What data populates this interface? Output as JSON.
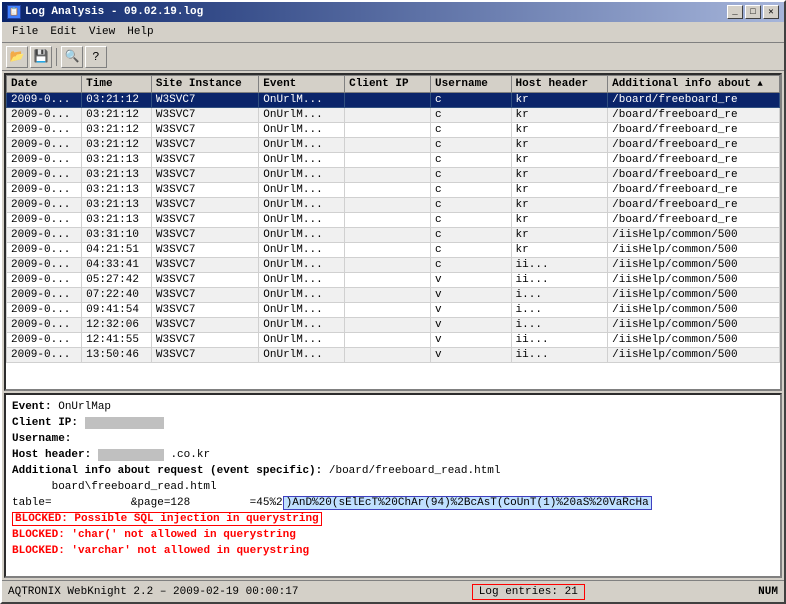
{
  "window": {
    "title": "Log Analysis - 09.02.19.log",
    "icon": "📋"
  },
  "menu": {
    "items": [
      "File",
      "Edit",
      "View",
      "Help"
    ]
  },
  "toolbar": {
    "buttons": [
      "open",
      "save",
      "separator",
      "find",
      "help"
    ]
  },
  "table": {
    "columns": [
      {
        "label": "Date",
        "width": 70
      },
      {
        "label": "Time",
        "width": 65
      },
      {
        "label": "Site Instance",
        "width": 100
      },
      {
        "label": "Event",
        "width": 80
      },
      {
        "label": "Client IP",
        "width": 80
      },
      {
        "label": "Username",
        "width": 75
      },
      {
        "label": "Host header",
        "width": 90
      },
      {
        "label": "Additional info about ^",
        "width": 160
      }
    ],
    "rows": [
      [
        "2009-0...",
        "03:21:12",
        "W3SVC7",
        "OnUrlM...",
        "",
        "c",
        "kr",
        "/board/freeboard_re"
      ],
      [
        "2009-0...",
        "03:21:12",
        "W3SVC7",
        "OnUrlM...",
        "",
        "c",
        "kr",
        "/board/freeboard_re"
      ],
      [
        "2009-0...",
        "03:21:12",
        "W3SVC7",
        "OnUrlM...",
        "",
        "c",
        "kr",
        "/board/freeboard_re"
      ],
      [
        "2009-0...",
        "03:21:12",
        "W3SVC7",
        "OnUrlM...",
        "",
        "c",
        "kr",
        "/board/freeboard_re"
      ],
      [
        "2009-0...",
        "03:21:13",
        "W3SVC7",
        "OnUrlM...",
        "",
        "c",
        "kr",
        "/board/freeboard_re"
      ],
      [
        "2009-0...",
        "03:21:13",
        "W3SVC7",
        "OnUrlM...",
        "",
        "c",
        "kr",
        "/board/freeboard_re"
      ],
      [
        "2009-0...",
        "03:21:13",
        "W3SVC7",
        "OnUrlM...",
        "",
        "c",
        "kr",
        "/board/freeboard_re"
      ],
      [
        "2009-0...",
        "03:21:13",
        "W3SVC7",
        "OnUrlM...",
        "",
        "c",
        "kr",
        "/board/freeboard_re"
      ],
      [
        "2009-0...",
        "03:21:13",
        "W3SVC7",
        "OnUrlM...",
        "",
        "c",
        "kr",
        "/board/freeboard_re"
      ],
      [
        "2009-0...",
        "03:31:10",
        "W3SVC7",
        "OnUrlM...",
        "",
        "c",
        "kr",
        "/iisHelp/common/500"
      ],
      [
        "2009-0...",
        "04:21:51",
        "W3SVC7",
        "OnUrlM...",
        "",
        "c",
        "kr",
        "/iisHelp/common/500"
      ],
      [
        "2009-0...",
        "04:33:41",
        "W3SVC7",
        "OnUrlM...",
        "",
        "c",
        "ii...",
        "/iisHelp/common/500"
      ],
      [
        "2009-0...",
        "05:27:42",
        "W3SVC7",
        "OnUrlM...",
        "",
        "v",
        "ii...",
        "/iisHelp/common/500"
      ],
      [
        "2009-0...",
        "07:22:40",
        "W3SVC7",
        "OnUrlM...",
        "",
        "v",
        "i...",
        "/iisHelp/common/500"
      ],
      [
        "2009-0...",
        "09:41:54",
        "W3SVC7",
        "OnUrlM...",
        "",
        "v",
        "i...",
        "/iisHelp/common/500"
      ],
      [
        "2009-0...",
        "12:32:06",
        "W3SVC7",
        "OnUrlM...",
        "",
        "v",
        "i...",
        "/iisHelp/common/500"
      ],
      [
        "2009-0...",
        "12:41:55",
        "W3SVC7",
        "OnUrlM...",
        "",
        "v",
        "ii...",
        "/iisHelp/common/500"
      ],
      [
        "2009-0...",
        "13:50:46",
        "W3SVC7",
        "OnUrlM...",
        "",
        "v",
        "ii...",
        "/iisHelp/common/500"
      ]
    ],
    "selected_row": 0
  },
  "detail": {
    "event_label": "Event:",
    "event_value": "OnUrlMap",
    "client_ip_label": "Client IP:",
    "client_ip_value": "██████████",
    "username_label": "Username:",
    "username_value": "",
    "host_header_label": "Host header:",
    "host_header_value": "██████████.co.kr",
    "additional_label": "Additional info about request (event specific):",
    "additional_value": "/board/freeboard_read.html",
    "url_line": "     board\\freeboard_read.html",
    "query_line": "table=                &page=128         =45%2",
    "query_highlight": ")AnD%20(sElEcT%20ChAr(94)%2BcAsT(CoUnT(1)%20aS%20VaRcHa",
    "blocked1_label": "BLOCKED:",
    "blocked1_value": "Possible SQL injection in querystring",
    "blocked2_label": "BLOCKED:",
    "blocked2_value": "'char(' not allowed in querystring",
    "blocked3_label": "BLOCKED:",
    "blocked3_value": "'varchar' not allowed in querystring"
  },
  "statusbar": {
    "left": "AQTRONIX WebKnight 2.2 – 2009-02-19 00:00:17",
    "center": "Log entries: 21",
    "right": "NUM"
  }
}
